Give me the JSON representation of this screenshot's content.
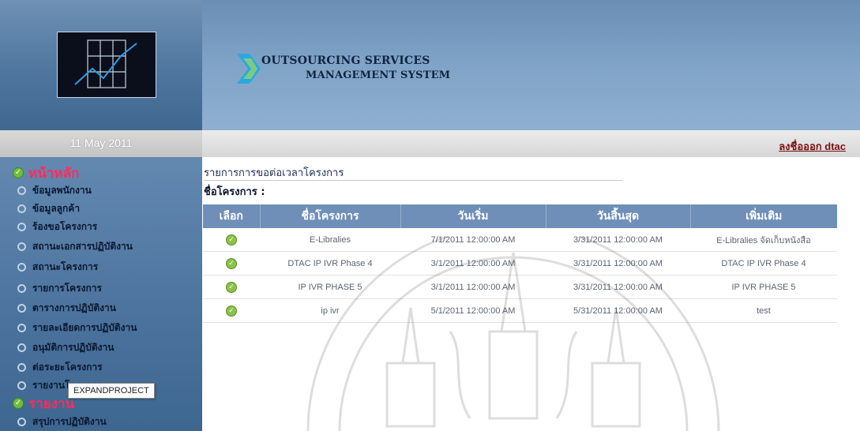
{
  "header": {
    "banner_line1": "OUTSOURCING SERVICES",
    "banner_line2": "MANAGEMENT SYSTEM",
    "date": "11 May 2011",
    "logout_label": "ลงชื่อออก dtac"
  },
  "sidebar": {
    "section1": "หน้าหลัก",
    "items": [
      "ข้อมูลพนักงาน",
      "ข้อมูลลูกค้า",
      "ร้องขอโครงการ",
      "สถานะเอกสารปฏิบัติงาน",
      "สถานะโครงการ",
      "รายการโครงการ",
      "ตารางการปฏิบัติงาน",
      "รายละเอียดการปฏิบัติงาน",
      "อนุมัติการปฏิบัติงาน",
      "ต่อระยะโครงการ",
      "รายงานโครงการ"
    ],
    "section2": "รายงาน",
    "items2": [
      "สรุปการปฏิบัติงาน"
    ],
    "tooltip": "EXPANDPROJECT"
  },
  "main": {
    "page_heading": "รายการการขอต่อเวลาโครงการ",
    "project_label": "ชื่อโครงการ :",
    "columns": [
      "เลือก",
      "ชื่อโครงการ",
      "วันเริ่ม",
      "วันสิ้นสุด",
      "เพิ่มเติม"
    ],
    "rows": [
      [
        "E-Libralies",
        "7/1/2011 12:00:00 AM",
        "3/31/2011 12:00:00 AM",
        "E-Libralies จัดเก็บหนังสือ"
      ],
      [
        "DTAC IP IVR Phase 4",
        "3/1/2011 12:00:00 AM",
        "3/31/2011 12:00:00 AM",
        "DTAC IP IVR Phase 4"
      ],
      [
        "IP IVR PHASE 5",
        "3/1/2011 12:00:00 AM",
        "3/31/2011 12:00:00 AM",
        "IP IVR PHASE 5"
      ],
      [
        "ip ivr",
        "5/1/2011 12:00:00 AM",
        "5/31/2011 12:00:00 AM",
        "test"
      ]
    ]
  },
  "colors": {
    "accent": "#6f8fb8",
    "sidebar": "#4a729c",
    "heading_red": "#ff2b5a"
  }
}
